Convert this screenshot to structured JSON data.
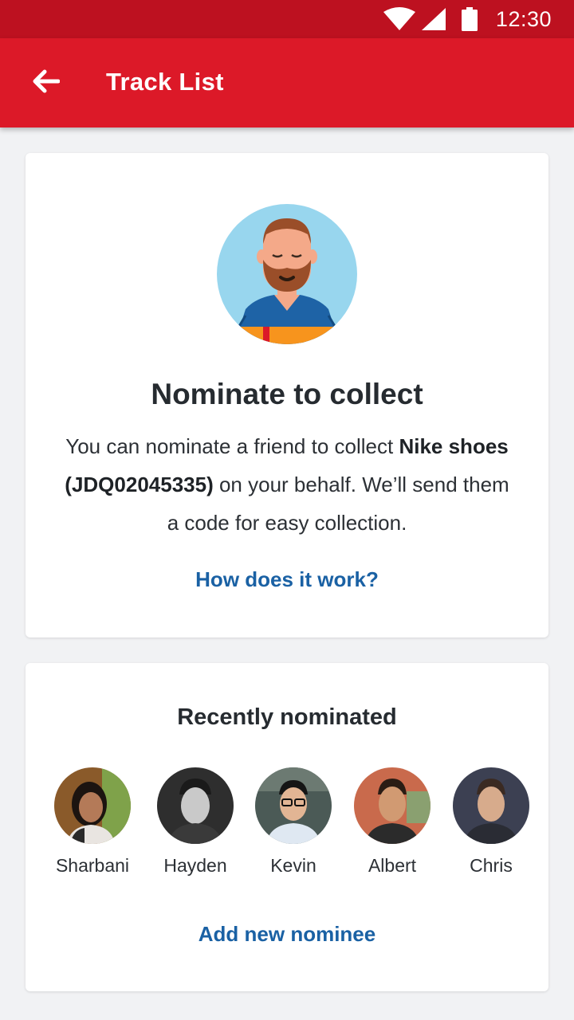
{
  "status_bar": {
    "time": "12:30",
    "icons": [
      "wifi-icon",
      "cell-signal-icon",
      "battery-icon"
    ]
  },
  "app_bar": {
    "title": "Track List",
    "back_icon": "arrow-left-icon"
  },
  "nominate_card": {
    "illustration": "bearded-man-illustration",
    "title": "Nominate to collect",
    "desc_prefix": "You can nominate a friend to collect ",
    "desc_bold": "Nike shoes (JDQ02045335)",
    "desc_suffix": " on your behalf. We’ll send them a code for easy collection.",
    "link": "How does it work?"
  },
  "recent_card": {
    "title": "Recently nominated",
    "nominees": [
      {
        "name": "Sharbani"
      },
      {
        "name": "Hayden"
      },
      {
        "name": "Kevin"
      },
      {
        "name": "Albert"
      },
      {
        "name": "Chris"
      }
    ],
    "add_link": "Add new nominee"
  },
  "colors": {
    "status_bar": "#bd1120",
    "app_bar": "#dc1928",
    "link": "#1a61a4",
    "background": "#f1f2f4"
  }
}
